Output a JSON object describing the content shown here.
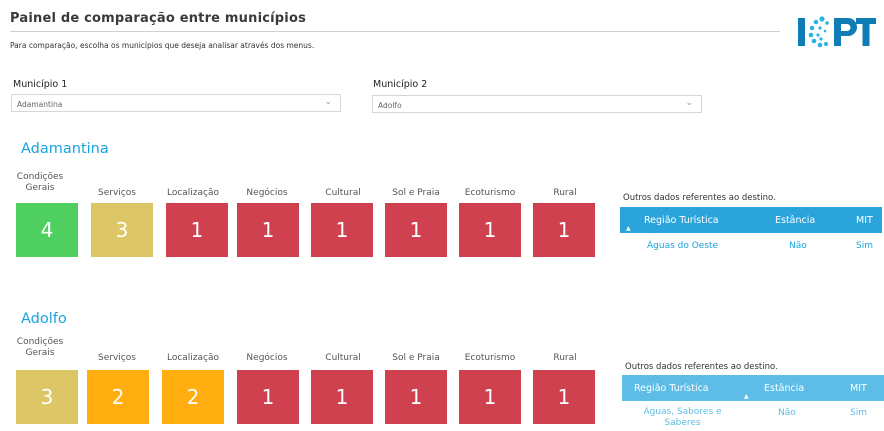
{
  "header": {
    "title": "Painel de comparação entre municípios",
    "subtitle": "Para comparação, escolha os municípios que deseja analisar através dos menus.",
    "logo_text": "ICPT"
  },
  "selectors": {
    "m1_label": "Município 1",
    "m1_value": "Adamantina",
    "m2_label": "Município 2",
    "m2_value": "Adolfo"
  },
  "categories": [
    "Condições Gerais",
    "Serviços",
    "Localização",
    "Negócios",
    "Cultural",
    "Sol e Praia",
    "Ecoturismo",
    "Rural"
  ],
  "municipios": [
    {
      "name": "Adamantina",
      "scores": [
        "4",
        "3",
        "1",
        "1",
        "1",
        "1",
        "1",
        "1"
      ],
      "colors": [
        "#4fcf5f",
        "#ddc666",
        "#d0414f",
        "#d0414f",
        "#d0414f",
        "#d0414f",
        "#d0414f",
        "#d0414f"
      ],
      "others": {
        "title": "Outros dados referentes ao destino.",
        "headers": [
          "Região Turística",
          "Estância",
          "MIT"
        ],
        "row": [
          "Águas do Oeste",
          "Não",
          "Sim"
        ]
      }
    },
    {
      "name": "Adolfo",
      "scores": [
        "3",
        "2",
        "2",
        "1",
        "1",
        "1",
        "1",
        "1"
      ],
      "colors": [
        "#ddc666",
        "#ffad0f",
        "#ffad0f",
        "#d0414f",
        "#d0414f",
        "#d0414f",
        "#d0414f",
        "#d0414f"
      ],
      "others": {
        "title": "Outros dados referentes ao destino.",
        "headers": [
          "Região Turística",
          "Estância",
          "MIT"
        ],
        "row": [
          "Águas, Sabores e Saberes",
          "Não",
          "Sim"
        ]
      }
    }
  ],
  "icons": [
    "chevron-down-icon",
    "sort-up-icon",
    "icpt-logo"
  ]
}
